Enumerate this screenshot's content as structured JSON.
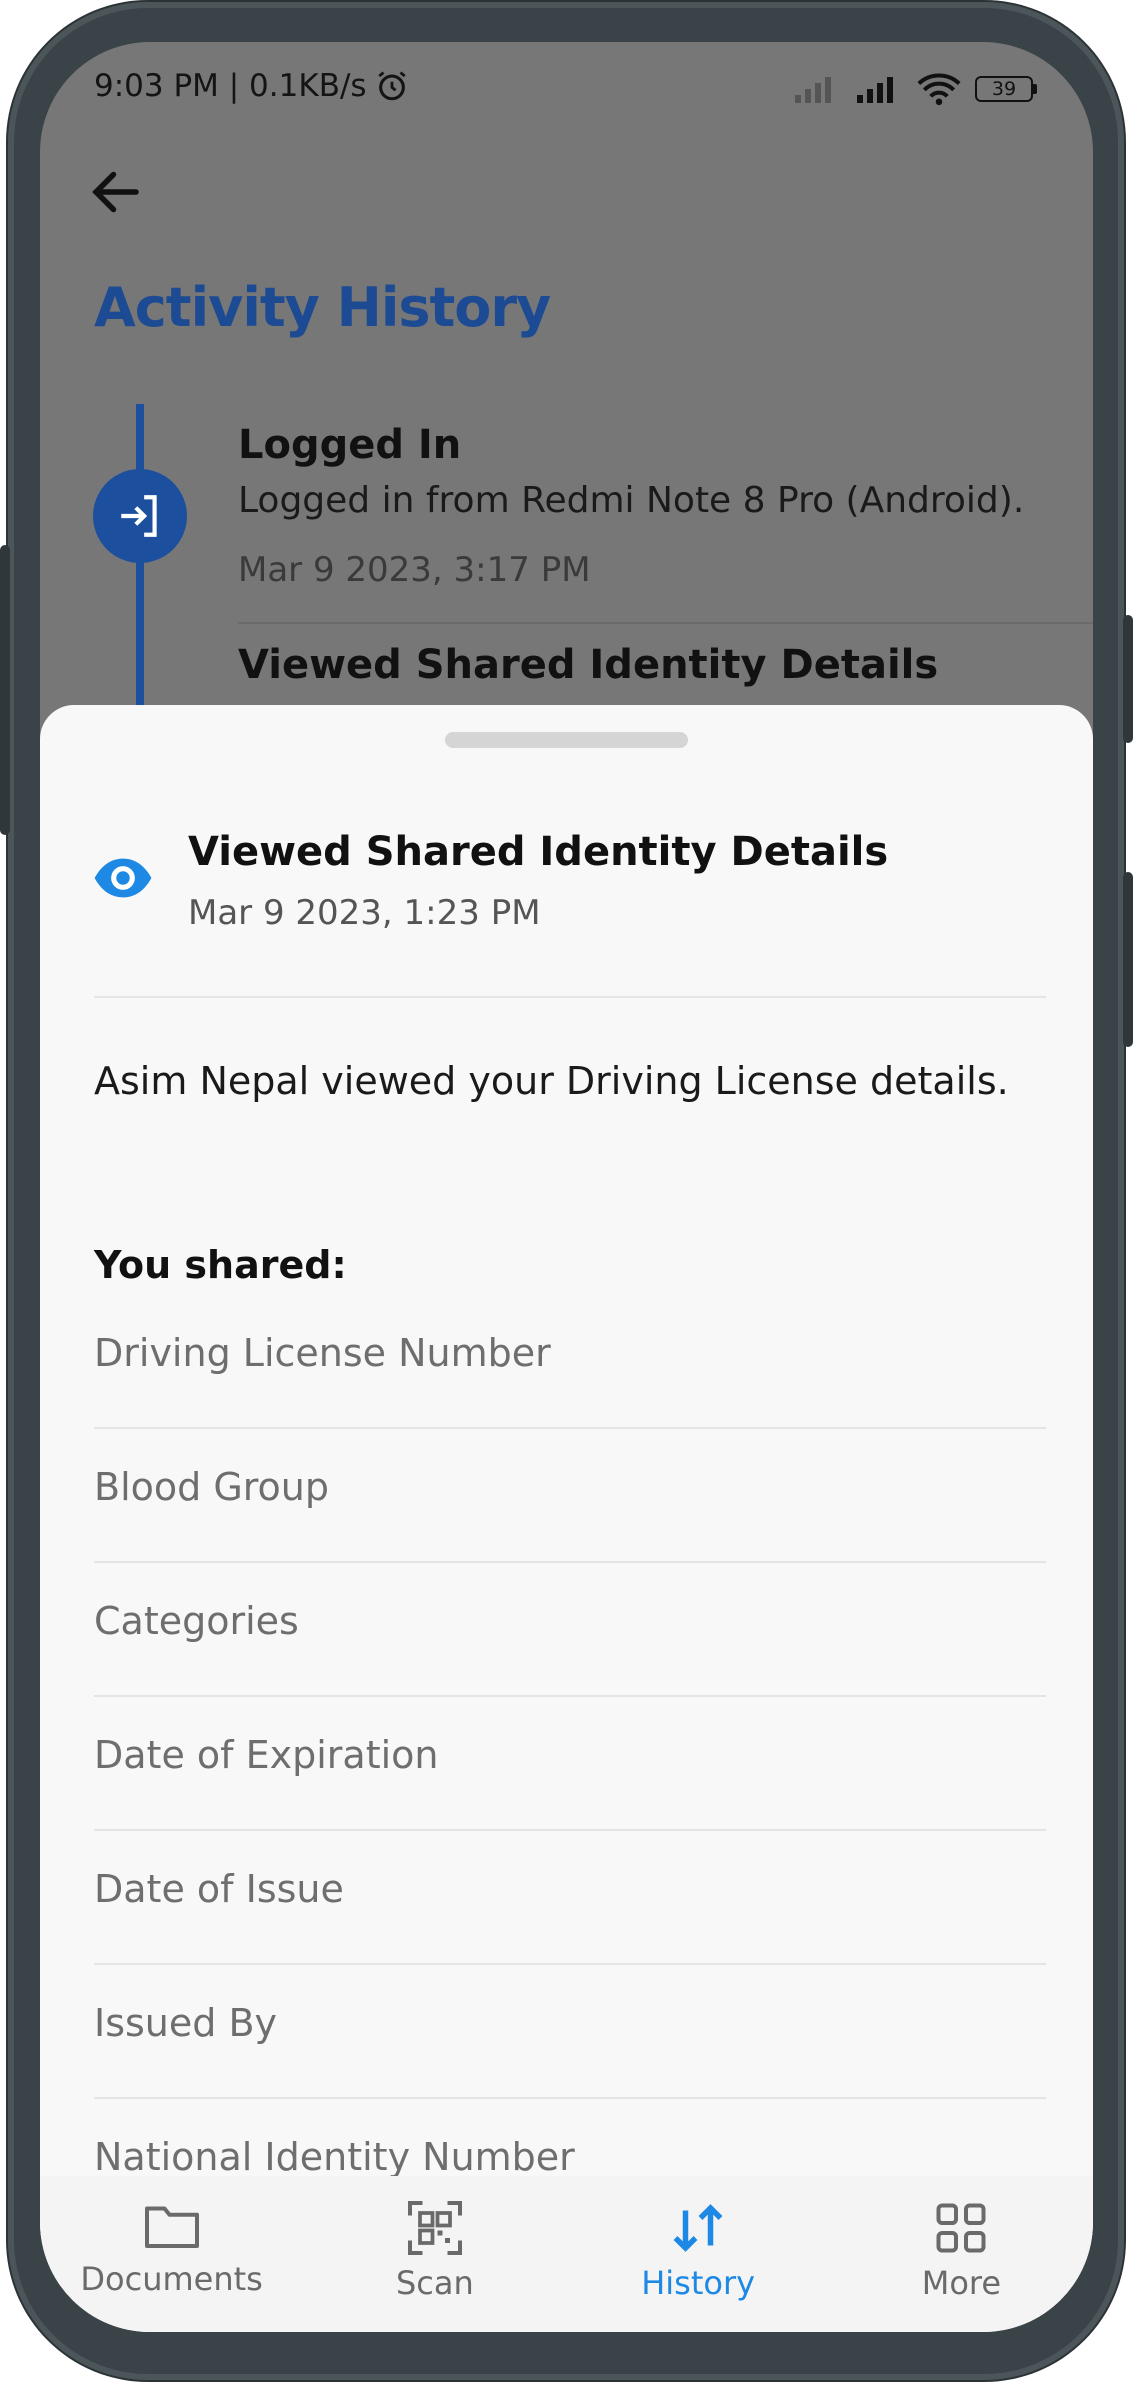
{
  "status_bar": {
    "time_speed": "9:03 PM | 0.1KB/s",
    "battery": "39"
  },
  "header": {
    "title": "Activity History"
  },
  "timeline": {
    "entry1": {
      "title": "Logged In",
      "description": "Logged in from Redmi Note 8 Pro (Android).",
      "time": "Mar 9 2023, 3:17 PM"
    },
    "entry2": {
      "title": "Viewed Shared Identity Details"
    }
  },
  "sheet": {
    "title": "Viewed Shared Identity Details",
    "time": "Mar 9 2023, 1:23 PM",
    "description": "Asim Nepal viewed your Driving License details.",
    "shared_heading": "You shared:",
    "fields": [
      "Driving License Number",
      "Blood Group",
      "Categories",
      "Date of Expiration",
      "Date of Issue",
      "Issued By",
      "National Identity Number"
    ]
  },
  "nav": {
    "items": [
      {
        "label": "Documents",
        "icon": "folder-icon"
      },
      {
        "label": "Scan",
        "icon": "qr-scan-icon"
      },
      {
        "label": "History",
        "icon": "swap-arrows-icon"
      },
      {
        "label": "More",
        "icon": "grid-icon"
      }
    ],
    "active": "History"
  },
  "colors": {
    "accent": "#1e88e5",
    "title_blue": "#1c4b93",
    "timeline_blue": "#1d4f9f"
  }
}
